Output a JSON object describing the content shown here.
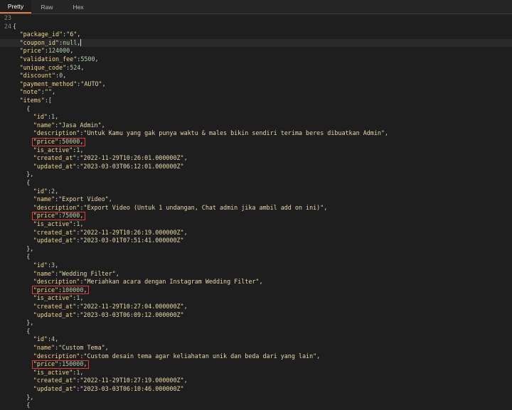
{
  "tabs": [
    "Pretty",
    "Raw",
    "Hex"
  ],
  "active_tab": "Pretty",
  "line_numbers": [
    "23",
    "24"
  ],
  "lines": [
    {
      "indent": 0,
      "parts": [
        {
          "t": "p",
          "v": ""
        }
      ]
    },
    {
      "indent": 0,
      "parts": [
        {
          "t": "p",
          "v": "{"
        }
      ]
    },
    {
      "indent": 1,
      "parts": [
        {
          "t": "k",
          "v": "\"package_id\""
        },
        {
          "t": "p",
          "v": ":"
        },
        {
          "t": "s",
          "v": "\"6\""
        },
        {
          "t": "p",
          "v": ","
        }
      ]
    },
    {
      "indent": 1,
      "parts": [
        {
          "t": "k",
          "v": "\"coupon_id\""
        },
        {
          "t": "p",
          "v": ":"
        },
        {
          "t": "n",
          "v": "null"
        },
        {
          "t": "p",
          "v": ","
        }
      ],
      "hl": true,
      "caret": true
    },
    {
      "indent": 1,
      "parts": [
        {
          "t": "k",
          "v": "\"price\""
        },
        {
          "t": "p",
          "v": ":"
        },
        {
          "t": "n",
          "v": "124000"
        },
        {
          "t": "p",
          "v": ","
        }
      ]
    },
    {
      "indent": 1,
      "parts": [
        {
          "t": "k",
          "v": "\"validation_fee\""
        },
        {
          "t": "p",
          "v": ":"
        },
        {
          "t": "n",
          "v": "5500"
        },
        {
          "t": "p",
          "v": ","
        }
      ]
    },
    {
      "indent": 1,
      "parts": [
        {
          "t": "k",
          "v": "\"unique_code\""
        },
        {
          "t": "p",
          "v": ":"
        },
        {
          "t": "n",
          "v": "524"
        },
        {
          "t": "p",
          "v": ","
        }
      ]
    },
    {
      "indent": 1,
      "parts": [
        {
          "t": "k",
          "v": "\"discount\""
        },
        {
          "t": "p",
          "v": ":"
        },
        {
          "t": "n",
          "v": "0"
        },
        {
          "t": "p",
          "v": ","
        }
      ]
    },
    {
      "indent": 1,
      "parts": [
        {
          "t": "k",
          "v": "\"payment_method\""
        },
        {
          "t": "p",
          "v": ":"
        },
        {
          "t": "s",
          "v": "\"AUTO\""
        },
        {
          "t": "p",
          "v": ","
        }
      ]
    },
    {
      "indent": 1,
      "parts": [
        {
          "t": "k",
          "v": "\"note\""
        },
        {
          "t": "p",
          "v": ":"
        },
        {
          "t": "s",
          "v": "\"\""
        },
        {
          "t": "p",
          "v": ","
        }
      ]
    },
    {
      "indent": 1,
      "parts": [
        {
          "t": "k",
          "v": "\"items\""
        },
        {
          "t": "p",
          "v": ":["
        }
      ]
    },
    {
      "indent": 2,
      "parts": [
        {
          "t": "p",
          "v": "{"
        }
      ]
    },
    {
      "indent": 3,
      "parts": [
        {
          "t": "k",
          "v": "\"id\""
        },
        {
          "t": "p",
          "v": ":"
        },
        {
          "t": "n",
          "v": "1"
        },
        {
          "t": "p",
          "v": ","
        }
      ]
    },
    {
      "indent": 3,
      "parts": [
        {
          "t": "k",
          "v": "\"name\""
        },
        {
          "t": "p",
          "v": ":"
        },
        {
          "t": "s",
          "v": "\"Jasa Admin\""
        },
        {
          "t": "p",
          "v": ","
        }
      ]
    },
    {
      "indent": 3,
      "parts": [
        {
          "t": "k",
          "v": "\"description\""
        },
        {
          "t": "p",
          "v": ":"
        },
        {
          "t": "s",
          "v": "\"Untuk Kamu yang gak punya waktu & males bikin sendiri terima beres dibuatkan Admin\""
        },
        {
          "t": "p",
          "v": ","
        }
      ]
    },
    {
      "indent": 3,
      "parts": [
        {
          "t": "k",
          "v": "\"price\""
        },
        {
          "t": "p",
          "v": ":"
        },
        {
          "t": "n",
          "v": "50000"
        },
        {
          "t": "p",
          "v": ","
        }
      ],
      "box": true
    },
    {
      "indent": 3,
      "parts": [
        {
          "t": "k",
          "v": "\"is_active\""
        },
        {
          "t": "p",
          "v": ":"
        },
        {
          "t": "n",
          "v": "1"
        },
        {
          "t": "p",
          "v": ","
        }
      ]
    },
    {
      "indent": 3,
      "parts": [
        {
          "t": "k",
          "v": "\"created_at\""
        },
        {
          "t": "p",
          "v": ":"
        },
        {
          "t": "s",
          "v": "\"2022-11-29T10:26:01.000000Z\""
        },
        {
          "t": "p",
          "v": ","
        }
      ]
    },
    {
      "indent": 3,
      "parts": [
        {
          "t": "k",
          "v": "\"updated_at\""
        },
        {
          "t": "p",
          "v": ":"
        },
        {
          "t": "s",
          "v": "\"2023-03-03T06:12:01.000000Z\""
        }
      ]
    },
    {
      "indent": 2,
      "parts": [
        {
          "t": "p",
          "v": "},"
        }
      ]
    },
    {
      "indent": 2,
      "parts": [
        {
          "t": "p",
          "v": "{"
        }
      ]
    },
    {
      "indent": 3,
      "parts": [
        {
          "t": "k",
          "v": "\"id\""
        },
        {
          "t": "p",
          "v": ":"
        },
        {
          "t": "n",
          "v": "2"
        },
        {
          "t": "p",
          "v": ","
        }
      ]
    },
    {
      "indent": 3,
      "parts": [
        {
          "t": "k",
          "v": "\"name\""
        },
        {
          "t": "p",
          "v": ":"
        },
        {
          "t": "s",
          "v": "\"Export Video\""
        },
        {
          "t": "p",
          "v": ","
        }
      ]
    },
    {
      "indent": 3,
      "parts": [
        {
          "t": "k",
          "v": "\"description\""
        },
        {
          "t": "p",
          "v": ":"
        },
        {
          "t": "s",
          "v": "\"Export Video (Untuk 1 undangan, Chat admin jika ambil add on ini)\""
        },
        {
          "t": "p",
          "v": ","
        }
      ]
    },
    {
      "indent": 3,
      "parts": [
        {
          "t": "k",
          "v": "\"price\""
        },
        {
          "t": "p",
          "v": ":"
        },
        {
          "t": "n",
          "v": "75000"
        },
        {
          "t": "p",
          "v": ","
        }
      ],
      "box": true
    },
    {
      "indent": 3,
      "parts": [
        {
          "t": "k",
          "v": "\"is_active\""
        },
        {
          "t": "p",
          "v": ":"
        },
        {
          "t": "n",
          "v": "1"
        },
        {
          "t": "p",
          "v": ","
        }
      ]
    },
    {
      "indent": 3,
      "parts": [
        {
          "t": "k",
          "v": "\"created_at\""
        },
        {
          "t": "p",
          "v": ":"
        },
        {
          "t": "s",
          "v": "\"2022-11-29T10:26:19.000000Z\""
        },
        {
          "t": "p",
          "v": ","
        }
      ]
    },
    {
      "indent": 3,
      "parts": [
        {
          "t": "k",
          "v": "\"updated_at\""
        },
        {
          "t": "p",
          "v": ":"
        },
        {
          "t": "s",
          "v": "\"2023-03-01T07:51:41.000000Z\""
        }
      ]
    },
    {
      "indent": 2,
      "parts": [
        {
          "t": "p",
          "v": "},"
        }
      ]
    },
    {
      "indent": 2,
      "parts": [
        {
          "t": "p",
          "v": "{"
        }
      ]
    },
    {
      "indent": 3,
      "parts": [
        {
          "t": "k",
          "v": "\"id\""
        },
        {
          "t": "p",
          "v": ":"
        },
        {
          "t": "n",
          "v": "3"
        },
        {
          "t": "p",
          "v": ","
        }
      ]
    },
    {
      "indent": 3,
      "parts": [
        {
          "t": "k",
          "v": "\"name\""
        },
        {
          "t": "p",
          "v": ":"
        },
        {
          "t": "s",
          "v": "\"Wedding Filter\""
        },
        {
          "t": "p",
          "v": ","
        }
      ]
    },
    {
      "indent": 3,
      "parts": [
        {
          "t": "k",
          "v": "\"description\""
        },
        {
          "t": "p",
          "v": ":"
        },
        {
          "t": "s",
          "v": "\"Meriahkan acara dengan Instagram Wedding Filter\""
        },
        {
          "t": "p",
          "v": ","
        }
      ]
    },
    {
      "indent": 3,
      "parts": [
        {
          "t": "k",
          "v": "\"price\""
        },
        {
          "t": "p",
          "v": ":"
        },
        {
          "t": "n",
          "v": "100000"
        },
        {
          "t": "p",
          "v": ","
        }
      ],
      "box": true
    },
    {
      "indent": 3,
      "parts": [
        {
          "t": "k",
          "v": "\"is_active\""
        },
        {
          "t": "p",
          "v": ":"
        },
        {
          "t": "n",
          "v": "1"
        },
        {
          "t": "p",
          "v": ","
        }
      ]
    },
    {
      "indent": 3,
      "parts": [
        {
          "t": "k",
          "v": "\"created_at\""
        },
        {
          "t": "p",
          "v": ":"
        },
        {
          "t": "s",
          "v": "\"2022-11-29T10:27:04.000000Z\""
        },
        {
          "t": "p",
          "v": ","
        }
      ]
    },
    {
      "indent": 3,
      "parts": [
        {
          "t": "k",
          "v": "\"updated_at\""
        },
        {
          "t": "p",
          "v": ":"
        },
        {
          "t": "s",
          "v": "\"2023-03-03T06:09:12.000000Z\""
        }
      ]
    },
    {
      "indent": 2,
      "parts": [
        {
          "t": "p",
          "v": "},"
        }
      ]
    },
    {
      "indent": 2,
      "parts": [
        {
          "t": "p",
          "v": "{"
        }
      ]
    },
    {
      "indent": 3,
      "parts": [
        {
          "t": "k",
          "v": "\"id\""
        },
        {
          "t": "p",
          "v": ":"
        },
        {
          "t": "n",
          "v": "4"
        },
        {
          "t": "p",
          "v": ","
        }
      ]
    },
    {
      "indent": 3,
      "parts": [
        {
          "t": "k",
          "v": "\"name\""
        },
        {
          "t": "p",
          "v": ":"
        },
        {
          "t": "s",
          "v": "\"Custom Tema\""
        },
        {
          "t": "p",
          "v": ","
        }
      ]
    },
    {
      "indent": 3,
      "parts": [
        {
          "t": "k",
          "v": "\"description\""
        },
        {
          "t": "p",
          "v": ":"
        },
        {
          "t": "s",
          "v": "\"Custom desain tema agar keliahatan unik dan beda dari yang lain\""
        },
        {
          "t": "p",
          "v": ","
        }
      ]
    },
    {
      "indent": 3,
      "parts": [
        {
          "t": "k",
          "v": "\"price\""
        },
        {
          "t": "p",
          "v": ":"
        },
        {
          "t": "n",
          "v": "150000"
        },
        {
          "t": "p",
          "v": ","
        }
      ],
      "box": true
    },
    {
      "indent": 3,
      "parts": [
        {
          "t": "k",
          "v": "\"is_active\""
        },
        {
          "t": "p",
          "v": ":"
        },
        {
          "t": "n",
          "v": "1"
        },
        {
          "t": "p",
          "v": ","
        }
      ]
    },
    {
      "indent": 3,
      "parts": [
        {
          "t": "k",
          "v": "\"created_at\""
        },
        {
          "t": "p",
          "v": ":"
        },
        {
          "t": "s",
          "v": "\"2022-11-29T10:27:19.000000Z\""
        },
        {
          "t": "p",
          "v": ","
        }
      ]
    },
    {
      "indent": 3,
      "parts": [
        {
          "t": "k",
          "v": "\"updated_at\""
        },
        {
          "t": "p",
          "v": ":"
        },
        {
          "t": "s",
          "v": "\"2023-03-03T06:10:46.000000Z\""
        }
      ]
    },
    {
      "indent": 2,
      "parts": [
        {
          "t": "p",
          "v": "},"
        }
      ]
    },
    {
      "indent": 2,
      "parts": [
        {
          "t": "p",
          "v": "{"
        }
      ]
    }
  ],
  "colors": {
    "key": "#f0d58a",
    "string": "#e8d9a8",
    "number": "#b5cea8",
    "highlight_box": "#e53935",
    "tab_accent": "#e07b39"
  }
}
